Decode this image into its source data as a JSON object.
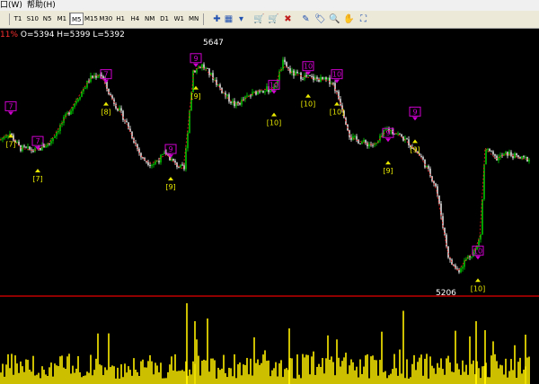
{
  "menu": {
    "window": "口(W)",
    "help": "帮助(H)"
  },
  "periods": [
    {
      "label": "T1",
      "active": false
    },
    {
      "label": "S10",
      "active": false
    },
    {
      "label": "N5",
      "active": false
    },
    {
      "label": "M1",
      "active": false
    },
    {
      "label": "M5",
      "active": true
    },
    {
      "label": "M15",
      "active": false
    },
    {
      "label": "M30",
      "active": false
    },
    {
      "label": "H1",
      "active": false
    },
    {
      "label": "H4",
      "active": false
    },
    {
      "label": "NM",
      "active": false
    },
    {
      "label": "D1",
      "active": false
    },
    {
      "label": "W1",
      "active": false
    },
    {
      "label": "MN",
      "active": false
    }
  ],
  "toolbar_icons": [
    "chart-plus-icon",
    "grid-icon",
    "dropdown-arrow-icon",
    "cart-add-icon",
    "cart-icon",
    "close-x-icon",
    "comment-icon",
    "tag-icon",
    "zoom-icon",
    "hand-icon",
    "bookmark-icon"
  ],
  "colors": {
    "up": "#00e000",
    "down": "#ffffff",
    "marker": "#d000d0",
    "label": "#e8e800",
    "ma": "#ff2020",
    "volume": "#ffee00",
    "line": "#c00000"
  },
  "ohlc": {
    "pct": "11%",
    "text": "O=5394 H=5399 L=5392"
  },
  "price_labels": {
    "high": "5647",
    "low": "5206"
  },
  "chart_data": {
    "type": "candlestick",
    "ylim": [
      5190,
      5660
    ],
    "path": [
      [
        0,
        5475
      ],
      [
        10,
        5490
      ],
      [
        22,
        5460
      ],
      [
        40,
        5455
      ],
      [
        55,
        5470
      ],
      [
        70,
        5510
      ],
      [
        85,
        5550
      ],
      [
        100,
        5590
      ],
      [
        112,
        5600
      ],
      [
        122,
        5560
      ],
      [
        140,
        5510
      ],
      [
        158,
        5440
      ],
      [
        170,
        5430
      ],
      [
        185,
        5450
      ],
      [
        195,
        5430
      ],
      [
        205,
        5420
      ],
      [
        215,
        5605
      ],
      [
        225,
        5615
      ],
      [
        238,
        5590
      ],
      [
        250,
        5560
      ],
      [
        262,
        5540
      ],
      [
        275,
        5555
      ],
      [
        290,
        5570
      ],
      [
        305,
        5570
      ],
      [
        315,
        5620
      ],
      [
        325,
        5600
      ],
      [
        335,
        5595
      ],
      [
        350,
        5590
      ],
      [
        370,
        5585
      ],
      [
        380,
        5540
      ],
      [
        390,
        5480
      ],
      [
        405,
        5470
      ],
      [
        418,
        5465
      ],
      [
        430,
        5495
      ],
      [
        440,
        5490
      ],
      [
        455,
        5470
      ],
      [
        470,
        5440
      ],
      [
        485,
        5390
      ],
      [
        500,
        5250
      ],
      [
        510,
        5230
      ],
      [
        520,
        5255
      ],
      [
        530,
        5270
      ],
      [
        535,
        5300
      ],
      [
        540,
        5460
      ],
      [
        552,
        5440
      ],
      [
        565,
        5450
      ],
      [
        580,
        5440
      ]
    ],
    "markers": [
      {
        "x": 12,
        "price": 5520,
        "up": "7",
        "down": "7"
      },
      {
        "x": 42,
        "price": 5455,
        "up": "7",
        "down": "7"
      },
      {
        "x": 118,
        "price": 5580,
        "up": "8",
        "down": "7"
      },
      {
        "x": 190,
        "price": 5440,
        "up": "9",
        "down": "9"
      },
      {
        "x": 218,
        "price": 5610,
        "up": "9",
        "down": "9"
      },
      {
        "x": 305,
        "price": 5560,
        "up": "10",
        "down": "10"
      },
      {
        "x": 343,
        "price": 5595,
        "up": "10",
        "down": "10"
      },
      {
        "x": 375,
        "price": 5580,
        "up": "10",
        "down": "10"
      },
      {
        "x": 432,
        "price": 5470,
        "up": "9",
        "down": "9"
      },
      {
        "x": 462,
        "price": 5510,
        "up": "9",
        "down": "9"
      },
      {
        "x": 532,
        "price": 5250,
        "up": "10",
        "down": "10"
      }
    ]
  }
}
